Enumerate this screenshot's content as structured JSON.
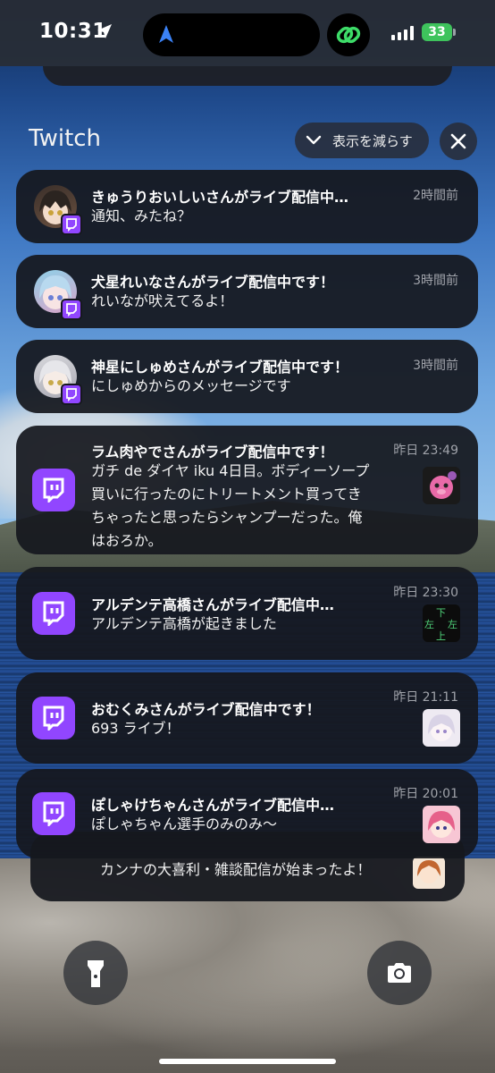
{
  "status_bar": {
    "time": "10:31",
    "battery": "33"
  },
  "group": {
    "title": "Twitch",
    "collapse_label": "表示を減らす"
  },
  "notifications": [
    {
      "title": "きゅうりおいしいさんがライブ配信中…",
      "time": "2時間前",
      "body": "通知、みたね？"
    },
    {
      "title": "犬星れいなさんがライブ配信中です！",
      "time": "3時間前",
      "body": "れいなが吠えてるよ！"
    },
    {
      "title": "神星にしゅめさんがライブ配信中です！",
      "time": "3時間前",
      "body": "にしゅめからのメッセージです"
    },
    {
      "title": "ラム肉やでさんがライブ配信中です！",
      "time": "昨日 23:49",
      "body_lines": [
        "ガチ de ダイヤ iku 4日目。ボディーソープ",
        "買いに行ったのにトリートメント買ってき",
        "ちゃったと思ったらシャンプーだった。俺",
        "はおろか。"
      ]
    },
    {
      "title": "アルデンテ高橋さんがライブ配信中…",
      "time": "昨日 23:30",
      "body": "アルデンテ高橋が起きました"
    },
    {
      "title": "おむくみさんがライブ配信中です！",
      "time": "昨日 21:11",
      "body": "693 ライブ！"
    },
    {
      "title": "ぽしゃけちゃんさんがライブ配信中…",
      "time": "昨日 20:01",
      "body": "ぽしゃちゃん選手のみのみ～"
    },
    {
      "body": "カンナの大喜利・雑談配信が始まったよ！"
    }
  ],
  "thumb_text": {
    "top": "下",
    "left": "左",
    "right": "左",
    "bottom": "上"
  },
  "colors": {
    "twitch_purple": "#9146ff",
    "card_bg": "#16181e",
    "battery_green": "#3ec35c"
  },
  "icons": [
    "location-arrow-icon",
    "navigation-icon",
    "link-icon",
    "signal-icon",
    "battery-icon",
    "chevron-down-icon",
    "close-icon",
    "twitch-icon",
    "flashlight-icon",
    "camera-icon"
  ]
}
